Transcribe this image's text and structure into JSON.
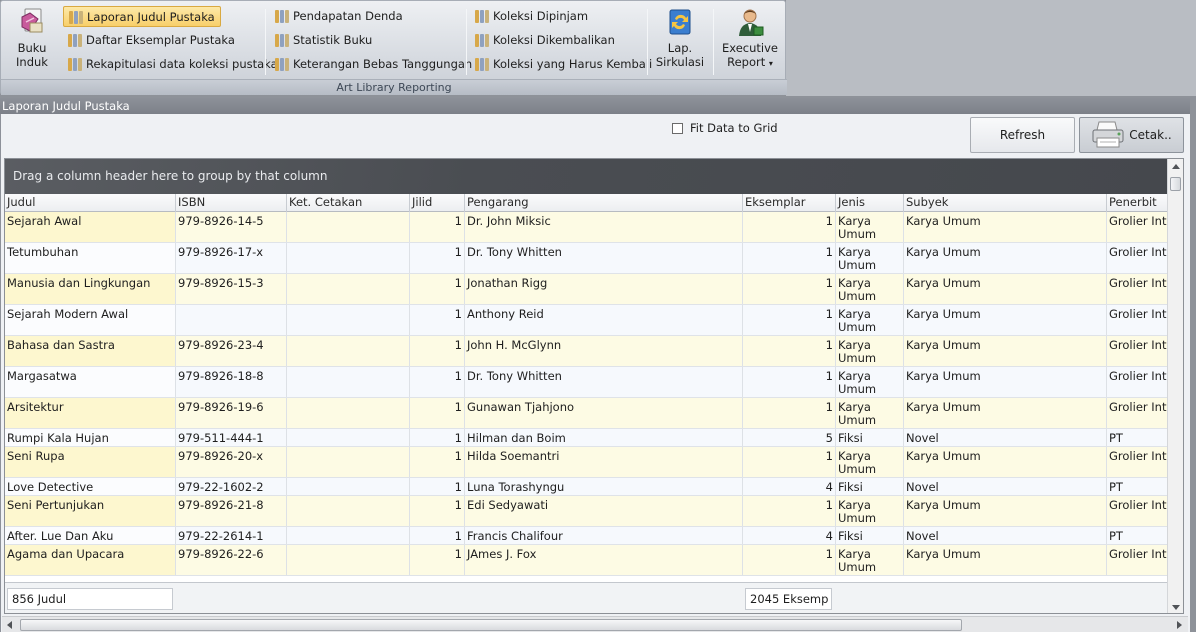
{
  "ribbon": {
    "buku_induk": {
      "line1": "Buku",
      "line2": "Induk"
    },
    "items_col1": [
      "Laporan Judul Pustaka",
      "Daftar Eksemplar Pustaka",
      "Rekapitulasi data koleksi pustaka"
    ],
    "items_col2": [
      "Pendapatan Denda",
      "Statistik Buku",
      "Keterangan Bebas Tanggungan"
    ],
    "items_col3": [
      "Koleksi Dipinjam",
      "Koleksi Dikembalikan",
      "Koleksi yang Harus Kembali"
    ],
    "lap_sirkulasi": {
      "line1": "Lap.",
      "line2": "Sirkulasi"
    },
    "executive_report": {
      "line1": "Executive",
      "line2": "Report"
    },
    "group_label": "Art Library Reporting",
    "active_item": "Laporan Judul Pustaka"
  },
  "window": {
    "title": "Laporan Judul Pustaka"
  },
  "toolbar": {
    "fit_label": "Fit Data to Grid",
    "fit_checked": false,
    "refresh_label": "Refresh",
    "print_label": "Cetak.."
  },
  "grid": {
    "group_hint": "Drag a column header here to group by that column",
    "columns": [
      "Judul",
      "ISBN",
      "Ket. Cetakan",
      "Jilid",
      "Pengarang",
      "Eksemplar",
      "Jenis",
      "Subyek",
      "Penerbit"
    ],
    "rows": [
      {
        "judul": "Sejarah Awal",
        "isbn": "979-8926-14-5",
        "ket": "",
        "jilid": "1",
        "pengarang": "Dr. John Miksic",
        "eksemplar": "1",
        "jenis": "Karya Umum",
        "subyek": "Karya Umum",
        "penerbit": "Grolier Int"
      },
      {
        "judul": "Tetumbuhan",
        "isbn": "979-8926-17-x",
        "ket": "",
        "jilid": "1",
        "pengarang": "Dr. Tony Whitten",
        "eksemplar": "1",
        "jenis": "Karya Umum",
        "subyek": "Karya Umum",
        "penerbit": "Grolier Int"
      },
      {
        "judul": "Manusia dan Lingkungan",
        "isbn": "979-8926-15-3",
        "ket": "",
        "jilid": "1",
        "pengarang": "Jonathan Rigg",
        "eksemplar": "1",
        "jenis": "Karya Umum",
        "subyek": "Karya Umum",
        "penerbit": "Grolier Int"
      },
      {
        "judul": "Sejarah Modern Awal",
        "isbn": "",
        "ket": "",
        "jilid": "1",
        "pengarang": "Anthony Reid",
        "eksemplar": "1",
        "jenis": "Karya Umum",
        "subyek": "Karya Umum",
        "penerbit": "Grolier Int"
      },
      {
        "judul": "Bahasa dan Sastra",
        "isbn": "979-8926-23-4",
        "ket": "",
        "jilid": "1",
        "pengarang": "John H. McGlynn",
        "eksemplar": "1",
        "jenis": "Karya Umum",
        "subyek": "Karya Umum",
        "penerbit": "Grolier Int"
      },
      {
        "judul": "Margasatwa",
        "isbn": "979-8926-18-8",
        "ket": "",
        "jilid": "1",
        "pengarang": "Dr. Tony Whitten",
        "eksemplar": "1",
        "jenis": "Karya Umum",
        "subyek": "Karya Umum",
        "penerbit": "Grolier Int"
      },
      {
        "judul": "Arsitektur",
        "isbn": "979-8926-19-6",
        "ket": "",
        "jilid": "1",
        "pengarang": "Gunawan Tjahjono",
        "eksemplar": "1",
        "jenis": "Karya Umum",
        "subyek": "Karya Umum",
        "penerbit": "Grolier Int"
      },
      {
        "judul": "Rumpi Kala Hujan",
        "isbn": "979-511-444-1",
        "ket": "",
        "jilid": "1",
        "pengarang": "Hilman dan Boim",
        "eksemplar": "5",
        "jenis": "Fiksi",
        "subyek": "Novel",
        "penerbit": "PT Gramed"
      },
      {
        "judul": "Seni Rupa",
        "isbn": "979-8926-20-x",
        "ket": "",
        "jilid": "1",
        "pengarang": "Hilda Soemantri",
        "eksemplar": "1",
        "jenis": "Karya Umum",
        "subyek": "Karya Umum",
        "penerbit": "Grolier Int"
      },
      {
        "judul": "Love Detective",
        "isbn": "979-22-1602-2",
        "ket": "",
        "jilid": "1",
        "pengarang": "Luna Torashyngu",
        "eksemplar": "4",
        "jenis": "Fiksi",
        "subyek": "Novel",
        "penerbit": "PT Gramed"
      },
      {
        "judul": "Seni Pertunjukan",
        "isbn": "979-8926-21-8",
        "ket": "",
        "jilid": "1",
        "pengarang": "Edi Sedyawati",
        "eksemplar": "1",
        "jenis": "Karya Umum",
        "subyek": "Karya Umum",
        "penerbit": "Grolier Int"
      },
      {
        "judul": "After. Lue Dan Aku",
        "isbn": "979-22-2614-1",
        "ket": "",
        "jilid": "1",
        "pengarang": "Francis Chalifour",
        "eksemplar": "4",
        "jenis": "Fiksi",
        "subyek": "Novel",
        "penerbit": "PT Gramed"
      },
      {
        "judul": "Agama dan Upacara",
        "isbn": "979-8926-22-6",
        "ket": "",
        "jilid": "1",
        "pengarang": "JAmes J. Fox",
        "eksemplar": "1",
        "jenis": "Karya Umum",
        "subyek": "Karya Umum",
        "penerbit": "Grolier Int"
      }
    ]
  },
  "summary": {
    "judul_count": "856 Judul",
    "eksemplar_count": "2045 Eksemp"
  }
}
